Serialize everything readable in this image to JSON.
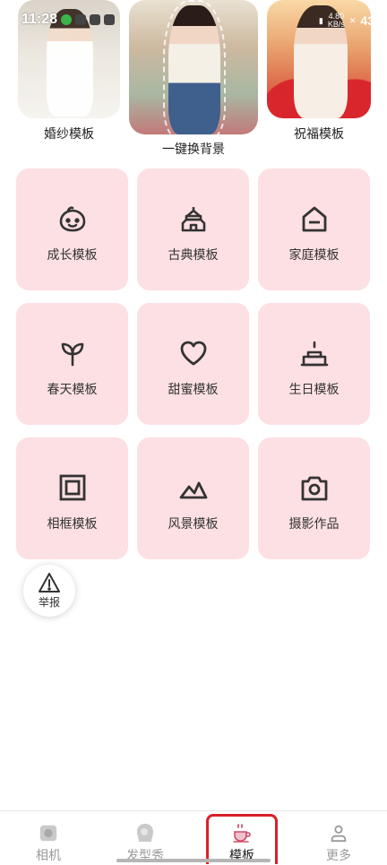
{
  "status_bar": {
    "time": "11:28",
    "net_speed_value": "4.80",
    "net_speed_unit": "KB/s",
    "battery": "43"
  },
  "banner": {
    "items": [
      {
        "label": "婚纱模板"
      },
      {
        "label": "一键换背景"
      },
      {
        "label": "祝福模板"
      }
    ]
  },
  "templates": {
    "icon_color": "#333333",
    "tile_color": "#fde0e3",
    "items": [
      {
        "label": "成长模板",
        "icon": "baby-face-icon"
      },
      {
        "label": "古典模板",
        "icon": "pagoda-icon"
      },
      {
        "label": "家庭模板",
        "icon": "house-icon"
      },
      {
        "label": "春天模板",
        "icon": "sprout-icon"
      },
      {
        "label": "甜蜜模板",
        "icon": "heart-icon"
      },
      {
        "label": "生日模板",
        "icon": "birthday-cake-icon"
      },
      {
        "label": "相框模板",
        "icon": "photo-frame-icon"
      },
      {
        "label": "风景模板",
        "icon": "mountain-icon"
      },
      {
        "label": "摄影作品",
        "icon": "camera-icon"
      }
    ]
  },
  "report": {
    "label": "举报",
    "icon": "warning-icon"
  },
  "bottom_nav": {
    "active_index": 2,
    "highlight_color": "#d8202a",
    "items": [
      {
        "label": "相机",
        "icon": "camera-nav-icon"
      },
      {
        "label": "发型秀",
        "icon": "hairstyle-nav-icon"
      },
      {
        "label": "模板",
        "icon": "teacup-nav-icon"
      },
      {
        "label": "更多",
        "icon": "person-nav-icon"
      }
    ]
  }
}
